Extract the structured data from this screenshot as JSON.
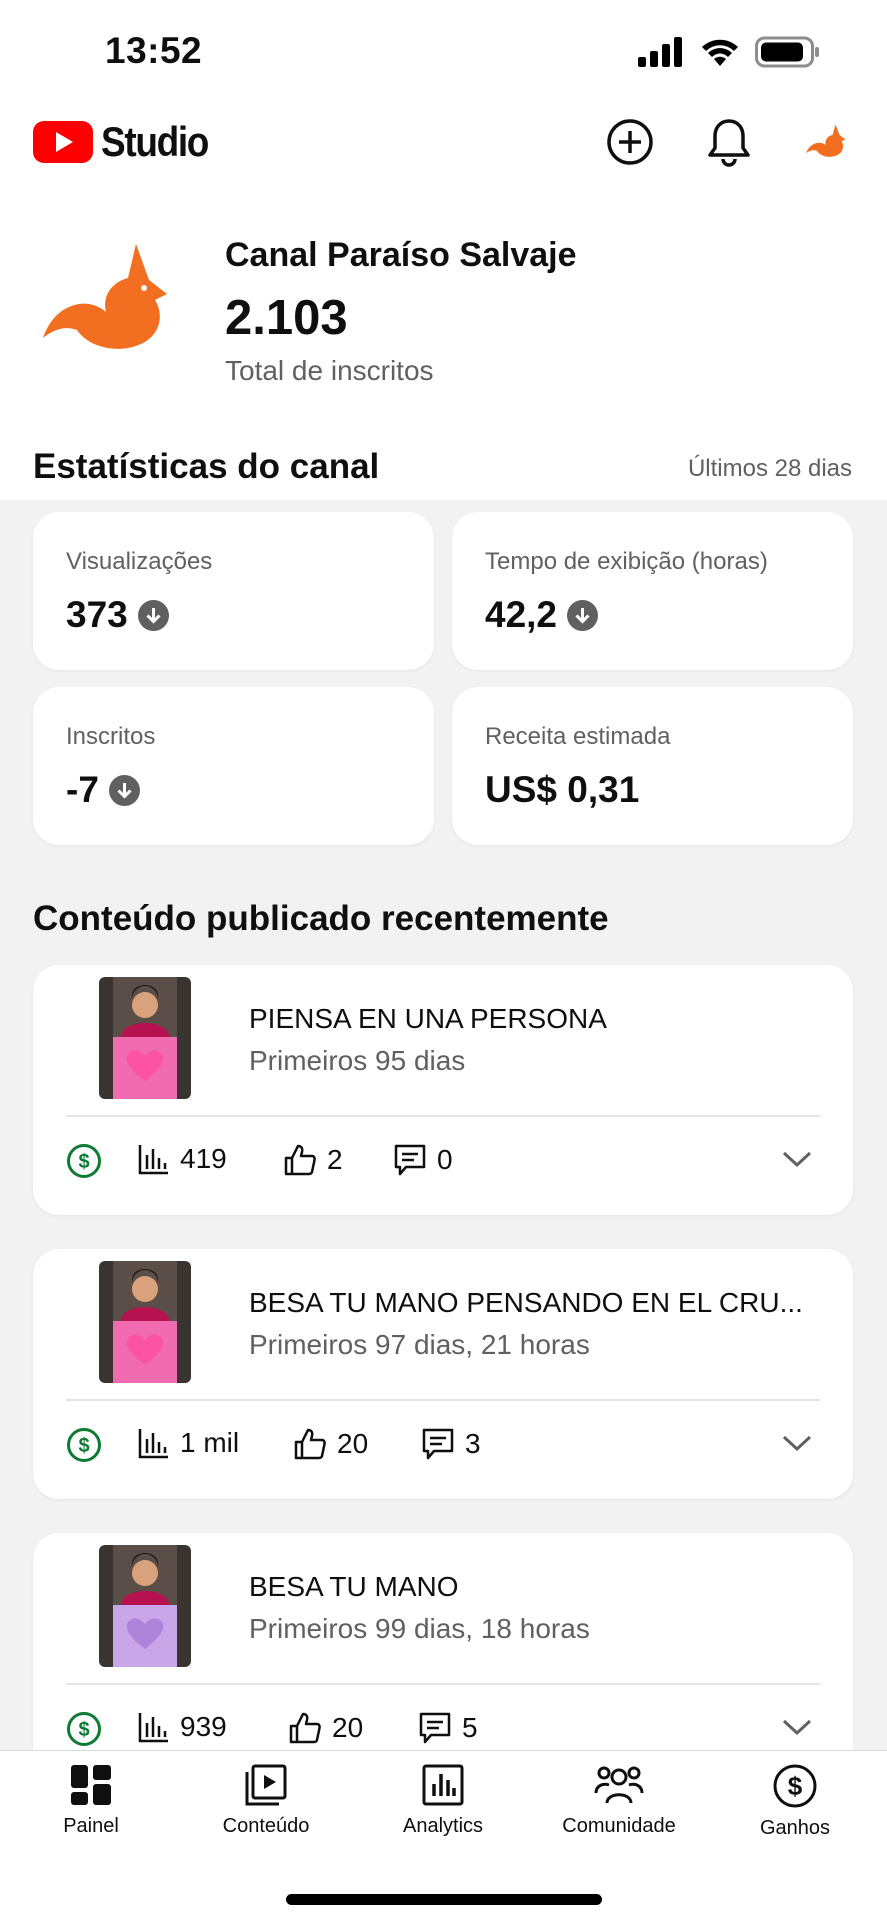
{
  "status_bar": {
    "time": "13:52"
  },
  "header": {
    "logo_text": "Studio",
    "icons": [
      "create-icon",
      "bell-icon",
      "avatar-fox-icon"
    ]
  },
  "channel": {
    "name": "Canal Paraíso Salvaje",
    "subscribers": "2.103",
    "subscribers_label": "Total de inscritos"
  },
  "stats": {
    "title": "Estatísticas do canal",
    "period": "Últimos 28 dias",
    "cards": [
      {
        "label": "Visualizações",
        "value": "373",
        "trend": "down"
      },
      {
        "label": "Tempo de exibição (horas)",
        "value": "42,2",
        "trend": "down"
      },
      {
        "label": "Inscritos",
        "value": "-7",
        "trend": "down"
      },
      {
        "label": "Receita estimada",
        "value": "US$ 0,31",
        "trend": "none"
      }
    ]
  },
  "recent": {
    "title": "Conteúdo publicado recentemente",
    "videos": [
      {
        "title": "PIENSA EN UNA PERSONA",
        "subtitle": "Primeiros 95 dias",
        "views": "419",
        "likes": "2",
        "comments": "0",
        "thumb_color": "#f06bb0"
      },
      {
        "title": "BESA TU MANO PENSANDO EN EL CRU...",
        "subtitle": "Primeiros 97 dias, 21 horas",
        "views": "1 mil",
        "likes": "20",
        "comments": "3",
        "thumb_color": "#f06bb0"
      },
      {
        "title": "BESA TU MANO",
        "subtitle": "Primeiros 99 dias, 18 horas",
        "views": "939",
        "likes": "20",
        "comments": "5",
        "thumb_color": "#c9a6e8"
      }
    ]
  },
  "nav": {
    "items": [
      {
        "label": "Painel",
        "icon": "dashboard-icon"
      },
      {
        "label": "Conteúdo",
        "icon": "content-icon"
      },
      {
        "label": "Analytics",
        "icon": "analytics-icon"
      },
      {
        "label": "Comunidade",
        "icon": "community-icon"
      },
      {
        "label": "Ganhos",
        "icon": "earnings-icon"
      }
    ]
  },
  "colors": {
    "brand_red": "#ff0000",
    "fox_orange": "#f26f21",
    "money_green": "#0f7a32",
    "background": "#f2f2f2"
  }
}
